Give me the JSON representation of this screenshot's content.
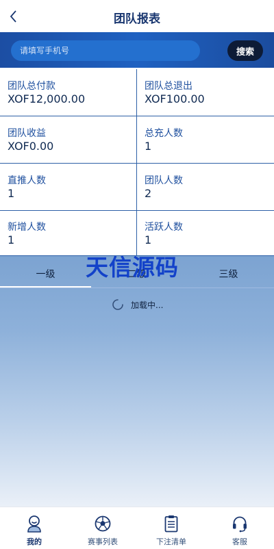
{
  "header": {
    "title": "团队报表",
    "back_icon": "chevron-left-icon"
  },
  "search": {
    "placeholder": "请填写手机号",
    "button_label": "搜索"
  },
  "stats": [
    {
      "label": "团队总付款",
      "value": "XOF12,000.00"
    },
    {
      "label": "团队总退出",
      "value": "XOF100.00"
    },
    {
      "label": "团队收益",
      "value": "XOF0.00"
    },
    {
      "label": "总充人数",
      "value": "1"
    },
    {
      "label": "直推人数",
      "value": "1"
    },
    {
      "label": "团队人数",
      "value": "2"
    },
    {
      "label": "新增人数",
      "value": "1"
    },
    {
      "label": "活跃人数",
      "value": "1"
    }
  ],
  "level_tabs": [
    {
      "label": "一级",
      "active": true
    },
    {
      "label": "二级",
      "active": false
    },
    {
      "label": "三级",
      "active": false
    }
  ],
  "loading": {
    "text": "加载中..."
  },
  "watermark": {
    "text": "天信源码"
  },
  "tabbar": [
    {
      "label": "我的",
      "icon": "user-icon",
      "active": true
    },
    {
      "label": "赛事列表",
      "icon": "soccer-ball-icon",
      "active": false
    },
    {
      "label": "下注清单",
      "icon": "clipboard-icon",
      "active": false
    },
    {
      "label": "客服",
      "icon": "headset-icon",
      "active": false
    }
  ],
  "colors": {
    "brand": "#1a3770",
    "search_bar": "#1f61c1",
    "search_button": "#0d1b36",
    "grid_line": "#2c5fa6",
    "watermark": "#1342c9"
  }
}
